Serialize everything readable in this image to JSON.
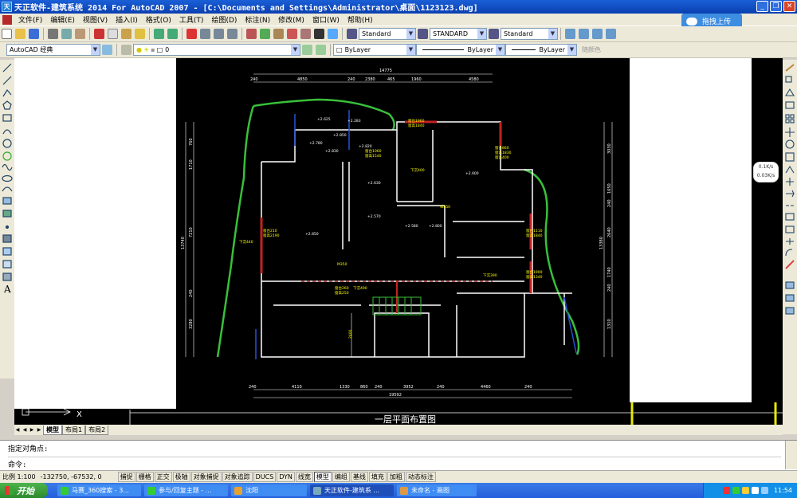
{
  "window": {
    "title": "天正软件-建筑系统 2014  For AutoCAD 2007 - [C:\\Documents and Settings\\Administrator\\桌面\\1123123.dwg]",
    "icon": "tz-app-icon"
  },
  "menu": {
    "items": [
      "文件(F)",
      "编辑(E)",
      "视图(V)",
      "插入(I)",
      "格式(O)",
      "工具(T)",
      "绘图(D)",
      "标注(N)",
      "修改(M)",
      "窗口(W)",
      "帮助(H)"
    ]
  },
  "upload_button": "拖拽上传",
  "toolbar1": {
    "text_style": "Standard",
    "dim_style": "STANDARD",
    "table_style": "Standard"
  },
  "toolbar2": {
    "workspace": "AutoCAD 经典",
    "layer": "0",
    "color": "ByLayer",
    "linetype": "ByLayer",
    "lineweight": "ByLayer",
    "plotstyle": "随颜色"
  },
  "speed_widget": {
    "up": "0.1K/s",
    "down": "0.03K/s"
  },
  "drawing": {
    "title": "一层平面布置图",
    "dims_top_total": "14775",
    "dims_top": [
      "240",
      "4850",
      "240",
      "2380",
      "465",
      "1960",
      "4580"
    ],
    "dims_bottom": [
      "240",
      "4110",
      "1330",
      "860",
      "240",
      "3952",
      "240",
      "4460",
      "240"
    ],
    "dims_bottom_total": "19592",
    "dims_left": [
      "760",
      "1710",
      "13740",
      "7210",
      "240",
      "3280"
    ],
    "dims_right": [
      "3030",
      "1650",
      "240",
      "2640",
      "13380",
      "1740",
      "240",
      "1310"
    ],
    "elevations": [
      "+2.625",
      "+2.283",
      "+2.780",
      "+2.850",
      "+2.830",
      "+2.820",
      "+2.600",
      "+2.630",
      "+2.570",
      "+2.580",
      "+2.800",
      "+2.850"
    ],
    "notes": [
      "窗台1960",
      "窗高1840",
      "窗台1060",
      "窗高1540",
      "窗台860",
      "窗高1830",
      "窗高400",
      "下沉400",
      "窗台210",
      "窗高2190",
      "下沉440",
      "窗台1110",
      "窗高1840",
      "窗台1900",
      "窗高1340",
      "下沉390",
      "下沉490",
      "窗台260",
      "窗高250",
      "M350",
      "W850",
      "2400"
    ]
  },
  "layout_tabs": [
    "模型",
    "布局1",
    "布局2"
  ],
  "command": {
    "history": "指定对角点:",
    "prompt": "命令:"
  },
  "status": {
    "scale": "比例 1:100",
    "coords": "-132750, -67532, 0",
    "buttons": [
      "捕捉",
      "栅格",
      "正交",
      "极轴",
      "对象捕捉",
      "对象追踪",
      "DUCS",
      "DYN",
      "线宽",
      "模型",
      "编组",
      "基线",
      "填充",
      "加粗",
      "动态标注"
    ]
  },
  "taskbar": {
    "start": "开始",
    "tasks": [
      {
        "label": "马赛_360搜索 - 3...",
        "active": false
      },
      {
        "label": "参与/回复主题 - ...",
        "active": false
      },
      {
        "label": "沈阳",
        "active": false
      },
      {
        "label": "天正软件-建筑系 ...",
        "active": true
      },
      {
        "label": "未命名 - 画图",
        "active": false
      }
    ],
    "clock": "11:54"
  },
  "colors": {
    "titlebar": "#0a3fb0",
    "drawing_bg": "#000000",
    "wall": "#ffffff",
    "garden": "#39c03a",
    "window_red": "#c32222",
    "dim_text": "#ffffff",
    "label_yellow": "#ffff00"
  }
}
